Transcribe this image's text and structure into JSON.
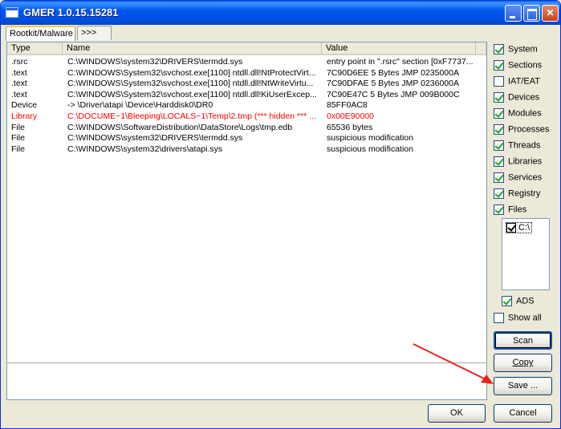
{
  "window": {
    "title": "GMER 1.0.15.15281"
  },
  "tabs": [
    {
      "label": "Rootkit/Malware"
    },
    {
      "label": ">>>"
    }
  ],
  "table": {
    "headers": {
      "type": "Type",
      "name": "Name",
      "value": "Value"
    },
    "rows": [
      {
        "type": ".rsrc",
        "name": "C:\\WINDOWS\\system32\\DRIVERS\\termdd.sys",
        "value": "entry point in \".rsrc\" section [0xF7737...",
        "hidden": false
      },
      {
        "type": ".text",
        "name": "C:\\WINDOWS\\System32\\svchost.exe[1100] ntdll.dll!NtProtectVirt...",
        "value": "7C90D6EE 5 Bytes  JMP 0235000A",
        "hidden": false
      },
      {
        "type": ".text",
        "name": "C:\\WINDOWS\\System32\\svchost.exe[1100] ntdll.dll!NtWriteVirtu...",
        "value": "7C90DFAE 5 Bytes  JMP 0236000A",
        "hidden": false
      },
      {
        "type": ".text",
        "name": "C:\\WINDOWS\\System32\\svchost.exe[1100] ntdll.dll!KiUserExcep...",
        "value": "7C90E47C 5 Bytes  JMP 009B000C",
        "hidden": false
      },
      {
        "type": "Device",
        "name": "-> \\Driver\\atapi \\Device\\Harddisk0\\DR0",
        "value": "85FF0AC8",
        "hidden": false
      },
      {
        "type": "Library",
        "name": "C:\\DOCUME~1\\Bleeping\\LOCALS~1\\Temp\\2.tmp (*** hidden *** ...",
        "value": "0x00E90000",
        "hidden": true
      },
      {
        "type": "File",
        "name": "C:\\WINDOWS\\SoftwareDistribution\\DataStore\\Logs\\tmp.edb",
        "value": "65536 bytes",
        "hidden": false
      },
      {
        "type": "File",
        "name": "C:\\WINDOWS\\system32\\DRIVERS\\termdd.sys",
        "value": "suspicious modification",
        "hidden": false
      },
      {
        "type": "File",
        "name": "C:\\WINDOWS\\system32\\drivers\\atapi.sys",
        "value": "suspicious modification",
        "hidden": false
      }
    ]
  },
  "options": [
    {
      "label": "System",
      "checked": true
    },
    {
      "label": "Sections",
      "checked": true
    },
    {
      "label": "IAT/EAT",
      "checked": false
    },
    {
      "label": "Devices",
      "checked": true
    },
    {
      "label": "Modules",
      "checked": true
    },
    {
      "label": "Processes",
      "checked": true
    },
    {
      "label": "Threads",
      "checked": true
    },
    {
      "label": "Libraries",
      "checked": true
    },
    {
      "label": "Services",
      "checked": true
    },
    {
      "label": "Registry",
      "checked": true
    },
    {
      "label": "Files",
      "checked": true
    }
  ],
  "drives": [
    {
      "label": "C:\\",
      "checked": true
    }
  ],
  "ads": {
    "label": "ADS",
    "checked": true
  },
  "show_all": {
    "label": "Show all",
    "checked": false
  },
  "buttons": {
    "scan": "Scan",
    "copy": "Copy",
    "save": "Save ...",
    "ok": "OK",
    "cancel": "Cancel"
  },
  "colors": {
    "hidden_text": "#ff0000",
    "titlebar": "#0058ee",
    "annotation_arrow": "#e8231e"
  }
}
